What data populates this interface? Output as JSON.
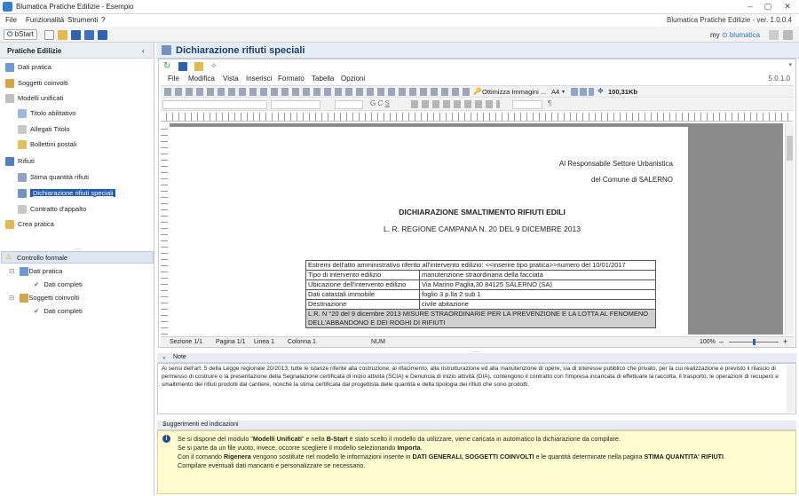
{
  "window": {
    "title": "Blumatica Pratiche Edilizie - Esempio",
    "version": "Blumatica Pratiche Edilizie - ver. 1.0.0.4"
  },
  "menu": [
    "File",
    "Funzionalità",
    "Strumenti",
    "?"
  ],
  "toolbar": {
    "bstart": "bStart",
    "brand": "my",
    "brand2": "blumatica"
  },
  "left": {
    "header": "Pratiche Edilizie",
    "items": [
      {
        "label": "Dati pratica"
      },
      {
        "label": "Soggetti coinvolti"
      },
      {
        "label": "Modelli unificati"
      },
      {
        "label": "Titolo abilitativo"
      },
      {
        "label": "Allegati Titolo"
      },
      {
        "label": "Bollettini postali"
      },
      {
        "label": "Rifiuti"
      },
      {
        "label": "Stima quantità rifiuti"
      },
      {
        "label": "Dichiarazione rifiuti speciali"
      },
      {
        "label": "Contratto d'appalto"
      },
      {
        "label": "Crea pratica"
      }
    ],
    "controllo": {
      "header": "Controllo formale",
      "items": [
        {
          "label": "Dati pratica"
        },
        {
          "label": "Dati completi"
        },
        {
          "label": "Soggetti coinvolti"
        },
        {
          "label": "Dati completi"
        }
      ]
    }
  },
  "doc": {
    "title": "Dichiarazione rifiuti speciali",
    "menu": [
      "File",
      "Modifica",
      "Vista",
      "Inserisci",
      "Formato",
      "Tabella",
      "Opzioni"
    ],
    "editor_version": "5.0.1.0",
    "optimize": "Ottimizza Immagini ...",
    "paper": "A4",
    "size": "100,31Kb",
    "recipient1": "Al Responsabile Settore Urbanistica",
    "recipient2": "del Comune di SALERNO",
    "heading": "DICHIARAZIONE SMALTIMENTO RIFIUTI EDILI",
    "subheading": "L. R. REGIONE CAMPANIA N. 20 DEL 9 DICEMBRE 2013",
    "table": [
      [
        "Estremi dell'atto amministrativo riferito all'intervento edilizio: <<inserire tipo pratica>>numero  del 10/01/2017"
      ],
      [
        "Tipo di intervento edilizio",
        "manutenzione straordinaria della facciata"
      ],
      [
        "Ubicazione dell'intervento edilizio",
        "Via Marino Paglia,30 84125 SALERNO (SA)"
      ],
      [
        "Dati catastali immobile",
        "foglio  3 p.lla 2 sub 1"
      ],
      [
        "Destinazione",
        "civile abitazione"
      ],
      [
        "L.R. N °20 del 9 dicembre 2013  MISURE STRAORDINARIE PER LA PREVENZIONE E LA LOTTA AL FENOMENO DELL'ABBANDONO E DEI ROGHI DI RIFIUTI"
      ]
    ],
    "status": {
      "sezione": "Sezione 1/1",
      "pagina": "Pagina 1/1",
      "linea": "Linea 1",
      "colonna": "Colonna 1",
      "num": "NUM",
      "zoom": "100%"
    }
  },
  "note": {
    "header": "Note",
    "text": "Ai sensi dell'art. 5 della Legge regionale 20/2013, tutte le istanze riferite alla costruzione, al rifacimento, alla ristrutturazione ed alla manutenzione di opere, sia di interesse pubblico che privato, per la cui realizzazione è previsto il rilascio di permesso di costruire o la presentazione della Segnalazione certificata di inizio attività (SCIA) e Denuncia di inizio attività (DIA), contengono il contratto con l'impresa incaricata di effettuare la raccolta, il trasporto, le operazioni di recupero e smaltimento dei rifiuti prodotti dal cantiere, nonché la stima certificata dal progettista delle quantità e della tipologia dei rifiuti che sono prodotti."
  },
  "suggestions": {
    "header": "Suggerimenti ed indicazioni",
    "l1a": "Se si dispone del modulo \"",
    "l1b": "Modelli Unificati",
    "l1c": "\" e nella ",
    "l1d": "B-Start",
    "l1e": " è stato scelto il modello da utilizzare, viene caricata in automatico la dichiarazione da compilare.",
    "l2a": "Se si parte da un file vuoto, invece, occorre scegliere il modello selezionando ",
    "l2b": "Importa",
    "l2c": ".",
    "l3a": "Con il comando ",
    "l3b": "Rigenera",
    "l3c": " vengono sostituite nel modello le informazioni inserite in ",
    "l3d": "DATI GENERALI, SOGGETTI COINVOLTI",
    "l3e": " e  le quantità determinate nella pagina ",
    "l3f": "STIMA QUANTITA' RIFIUTI",
    "l3g": ".",
    "l4": "Compilare eventuali dati mancanti e personalizzare se necessario."
  }
}
